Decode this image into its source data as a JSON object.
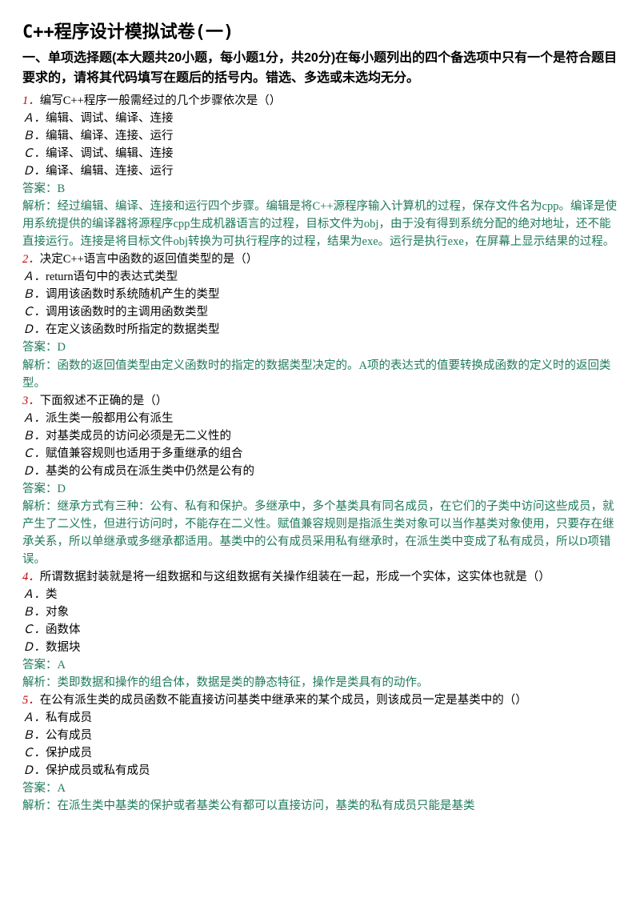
{
  "title": "C++程序设计模拟试卷(一)",
  "section": "一、单项选择题(本大题共20小题，每小题1分，共20分)在每小题列出的四个备选项中只有一个是符合题目要求的，请将其代码填写在题后的括号内。错选、多选或未选均无分。",
  "questions": [
    {
      "num": "1．",
      "text": "编写C++程序一般需经过的几个步骤依次是（）",
      "opts": [
        {
          "l": "Ａ．",
          "t": "编辑、调试、编译、连接"
        },
        {
          "l": "Ｂ．",
          "t": "编辑、编译、连接、运行"
        },
        {
          "l": "Ｃ．",
          "t": "编译、调试、编辑、连接"
        },
        {
          "l": "Ｄ．",
          "t": "编译、编辑、连接、运行"
        }
      ],
      "answer": "答案：B",
      "analysis": "解析：经过编辑、编译、连接和运行四个步骤。编辑是将C++源程序输入计算机的过程，保存文件名为cpp。编译是使用系统提供的编译器将源程序cpp生成机器语言的过程，目标文件为obj，由于没有得到系统分配的绝对地址，还不能直接运行。连接是将目标文件obj转换为可执行程序的过程，结果为exe。运行是执行exe，在屏幕上显示结果的过程。"
    },
    {
      "num": "2．",
      "text": "决定C++语言中函数的返回值类型的是（）",
      "opts": [
        {
          "l": "Ａ．",
          "t": "return语句中的表达式类型"
        },
        {
          "l": "Ｂ．",
          "t": "调用该函数时系统随机产生的类型"
        },
        {
          "l": "Ｃ．",
          "t": "调用该函数时的主调用函数类型"
        },
        {
          "l": "Ｄ．",
          "t": "在定义该函数时所指定的数据类型"
        }
      ],
      "answer": "答案：D",
      "analysis": "解析：函数的返回值类型由定义函数时的指定的数据类型决定的。A项的表达式的值要转换成函数的定义时的返回类型。"
    },
    {
      "num": "3．",
      "text": "下面叙述不正确的是（）",
      "opts": [
        {
          "l": "Ａ．",
          "t": "派生类一般都用公有派生"
        },
        {
          "l": "Ｂ．",
          "t": "对基类成员的访问必须是无二义性的"
        },
        {
          "l": "Ｃ．",
          "t": "赋值兼容规则也适用于多重继承的组合"
        },
        {
          "l": "Ｄ．",
          "t": "基类的公有成员在派生类中仍然是公有的"
        }
      ],
      "answer": "答案：D",
      "analysis": "解析：继承方式有三种：公有、私有和保护。多继承中，多个基类具有同名成员，在它们的子类中访问这些成员，就产生了二义性，但进行访问时，不能存在二义性。赋值兼容规则是指派生类对象可以当作基类对象使用，只要存在继承关系，所以单继承或多继承都适用。基类中的公有成员采用私有继承时，在派生类中变成了私有成员，所以D项错误。"
    },
    {
      "num": "4．",
      "text": "所谓数据封装就是将一组数据和与这组数据有关操作组装在一起，形成一个实体，这实体也就是（）",
      "opts": [
        {
          "l": "Ａ．",
          "t": "类"
        },
        {
          "l": "Ｂ．",
          "t": "对象"
        },
        {
          "l": "Ｃ．",
          "t": "函数体"
        },
        {
          "l": "Ｄ．",
          "t": "数据块"
        }
      ],
      "answer": "答案：A",
      "analysis": "解析：类即数据和操作的组合体，数据是类的静态特征，操作是类具有的动作。"
    },
    {
      "num": "5．",
      "text": "在公有派生类的成员函数不能直接访问基类中继承来的某个成员，则该成员一定是基类中的（）",
      "opts": [
        {
          "l": "Ａ．",
          "t": "私有成员"
        },
        {
          "l": "Ｂ．",
          "t": "公有成员"
        },
        {
          "l": "Ｃ．",
          "t": "保护成员"
        },
        {
          "l": "Ｄ．",
          "t": "保护成员或私有成员"
        }
      ],
      "answer": "答案：A",
      "analysis": "解析：在派生类中基类的保护或者基类公有都可以直接访问，基类的私有成员只能是基类"
    }
  ]
}
